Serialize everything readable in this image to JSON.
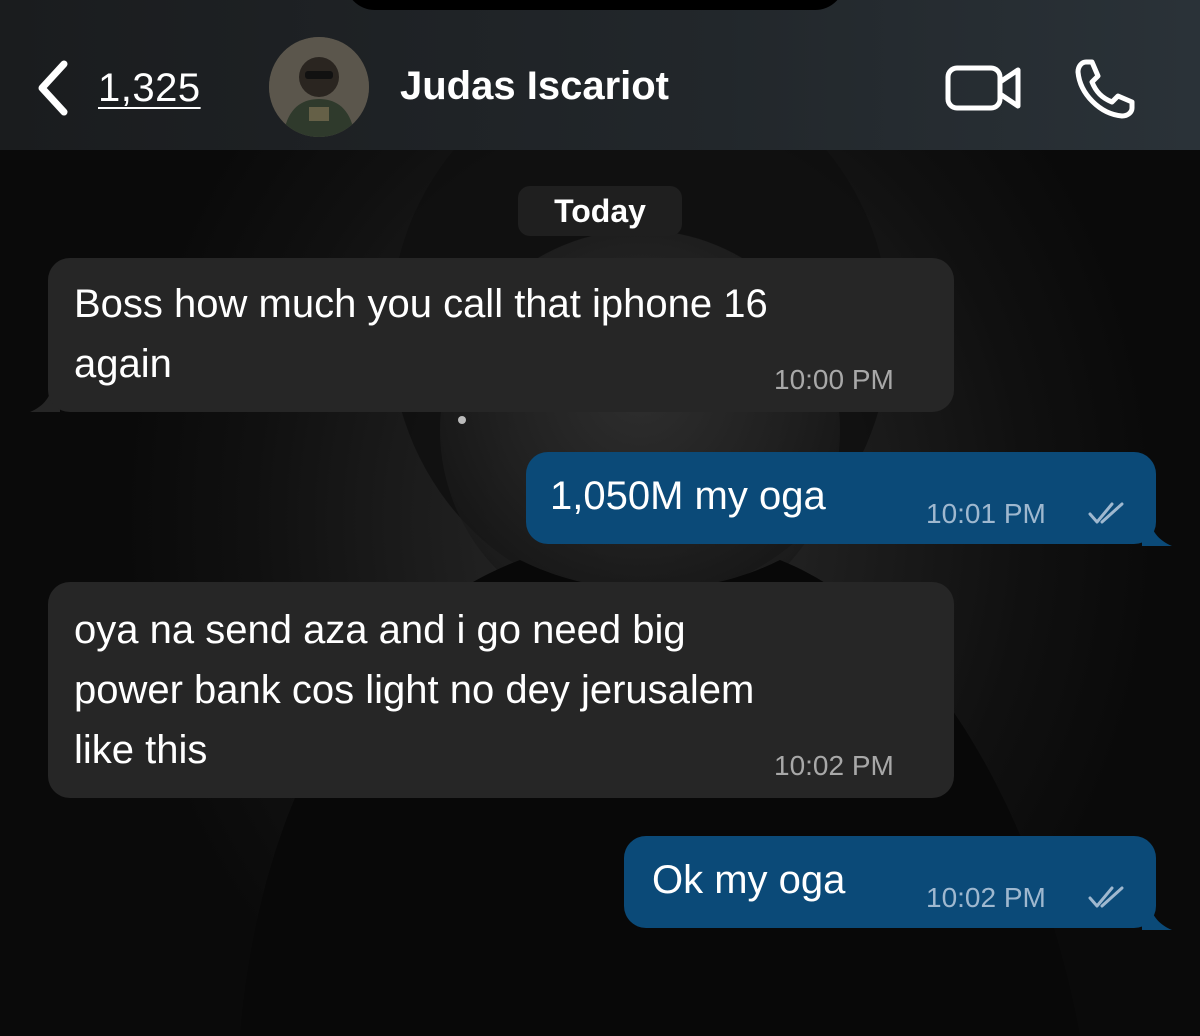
{
  "header": {
    "back_count": "1,325",
    "contact_name": "Judas Iscariot"
  },
  "chat": {
    "date_label": "Today",
    "messages": [
      {
        "direction": "incoming",
        "lines": [
          "Boss how much you call that iphone 16",
          "again"
        ],
        "time": "10:00 PM"
      },
      {
        "direction": "outgoing",
        "lines": [
          "1,050M my oga"
        ],
        "time": "10:01 PM",
        "status": "read"
      },
      {
        "direction": "incoming",
        "lines": [
          "oya na send aza and i go need big",
          "power bank cos light no dey jerusalem",
          "like this"
        ],
        "time": "10:02 PM"
      },
      {
        "direction": "outgoing",
        "lines": [
          "Ok my oga"
        ],
        "time": "10:02 PM",
        "status": "read"
      }
    ]
  },
  "colors": {
    "incoming_bubble": "#262626",
    "outgoing_bubble": "#0b4a78",
    "header_background": "#1e2225"
  },
  "icons": [
    "chevron-left-icon",
    "video-camera-icon",
    "phone-icon",
    "double-check-icon"
  ]
}
